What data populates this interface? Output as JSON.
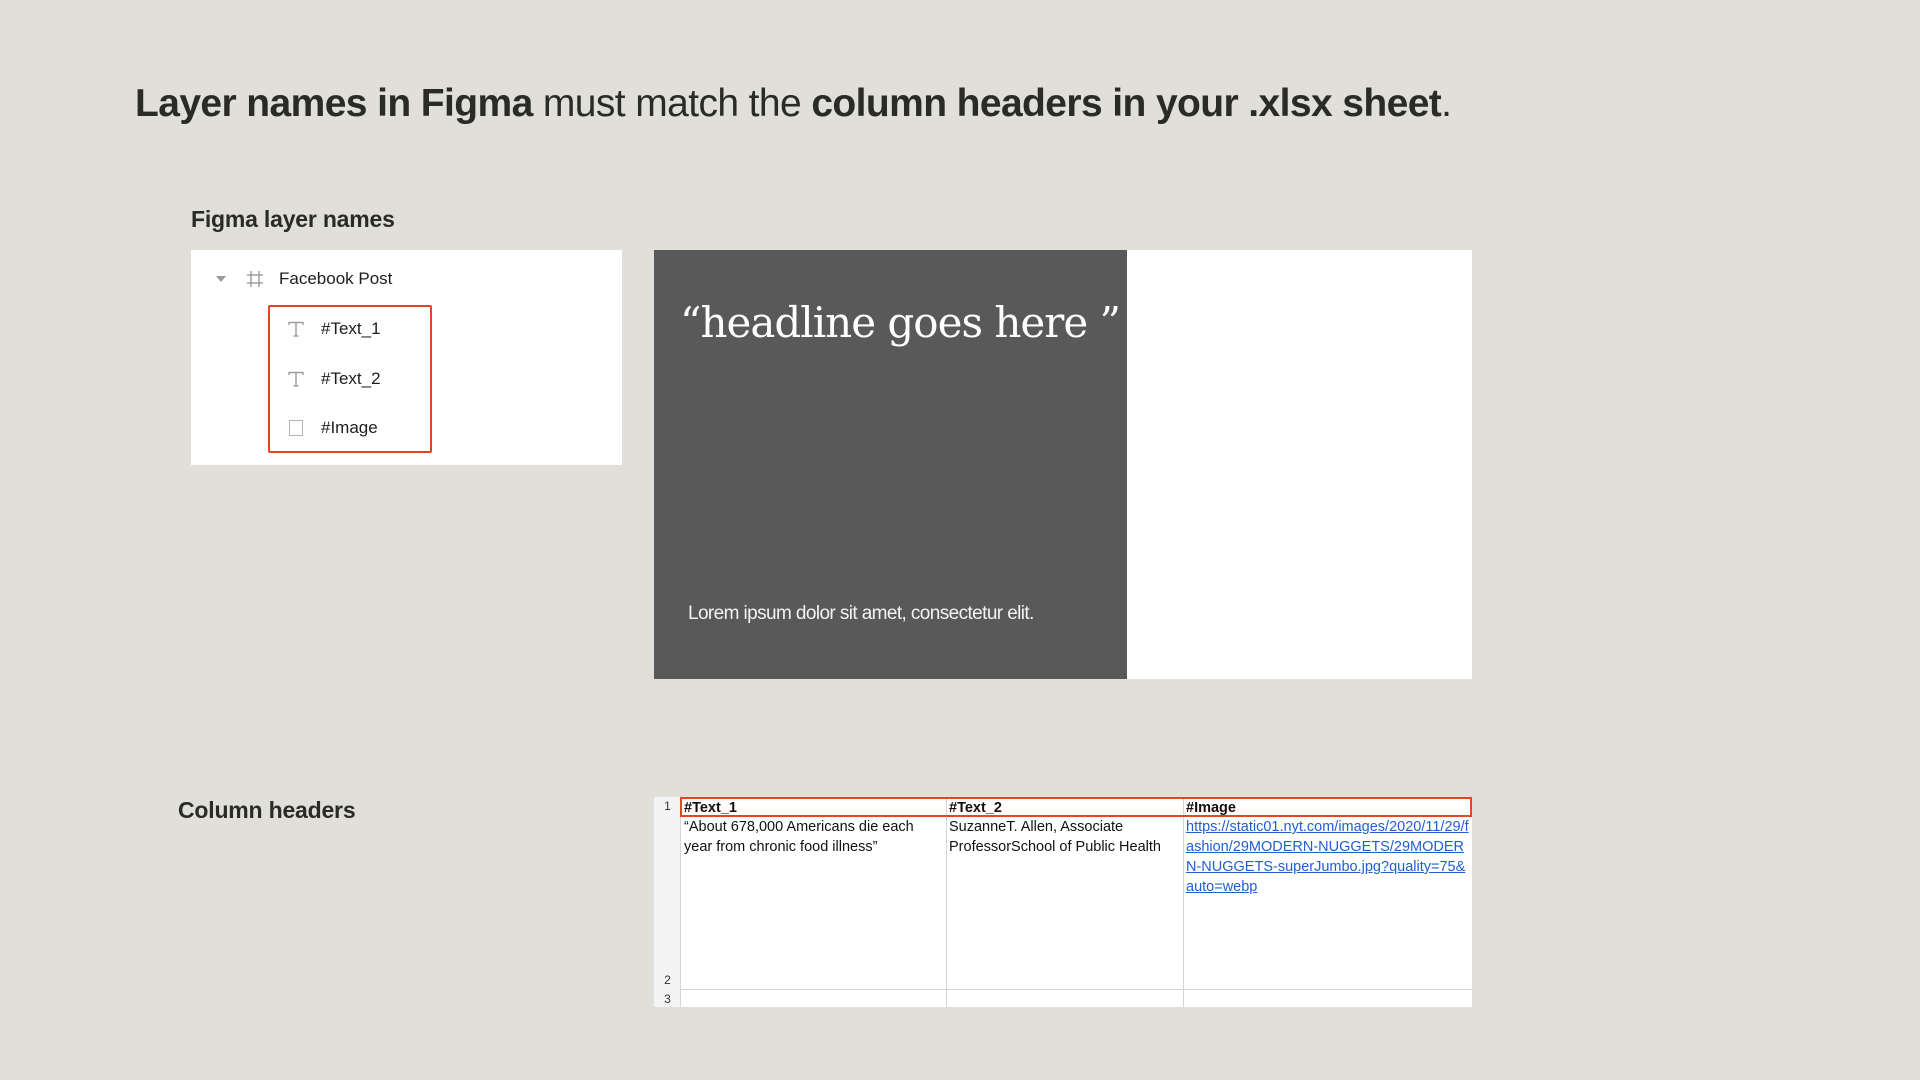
{
  "headline": {
    "part1": "Layer names in Figma",
    "part2": " must match the ",
    "part3": "column headers in your .xlsx sheet",
    "part4": "."
  },
  "figma_section": {
    "label": "Figma layer names",
    "frame_name": "Facebook Post",
    "layers": [
      {
        "name": "#Text_1",
        "icon": "text-icon"
      },
      {
        "name": "#Text_2",
        "icon": "text-icon"
      },
      {
        "name": "#Image",
        "icon": "rectangle-icon"
      }
    ],
    "highlight_color": "#e4471f"
  },
  "post_preview": {
    "headline": "“headline goes here ”",
    "body": "Lorem ipsum dolor sit amet, consectetur elit.",
    "dark_color": "#595959"
  },
  "sheet_section": {
    "label": "Column headers",
    "row_numbers": [
      "1",
      "2",
      "3"
    ],
    "headers": [
      "#Text_1",
      "#Text_2",
      "#Image"
    ],
    "row": [
      "“About 678,000 Americans die each year from chronic food illness”",
      "SuzanneT. Allen, Associate ProfessorSchool of Public Health",
      "https://static01.nyt.com/images/2020/11/29/fashion/29MODERN-NUGGETS/29MODERN-NUGGETS-superJumbo.jpg?quality=75&auto=webp"
    ]
  }
}
